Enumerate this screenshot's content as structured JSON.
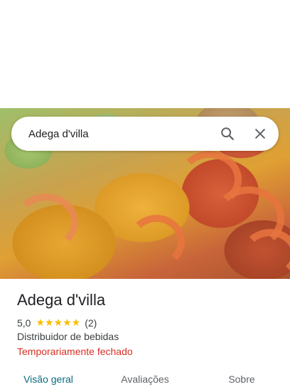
{
  "search": {
    "query": "Adega d'villa"
  },
  "place": {
    "name": "Adega d'villa",
    "rating": "5,0",
    "stars": "★★★★★",
    "review_count": "(2)",
    "category": "Distribuidor de bebidas",
    "status": "Temporariamente fechado"
  },
  "tabs": [
    {
      "label": "Visão geral",
      "active": true
    },
    {
      "label": "Avaliações",
      "active": false
    },
    {
      "label": "Sobre",
      "active": false
    }
  ],
  "colors": {
    "star": "#fbbc04",
    "status_closed": "#d93025",
    "active_tab": "#0b6b7e"
  },
  "icons": [
    "search-icon",
    "close-icon"
  ]
}
